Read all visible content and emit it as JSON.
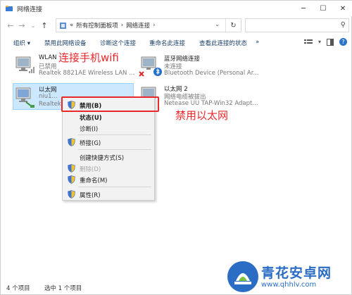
{
  "window": {
    "title": "网络连接"
  },
  "address": {
    "prefix": "«",
    "crumbs": [
      "所有控制面板项",
      "网络连接"
    ],
    "search_placeholder": ""
  },
  "commands": {
    "organize": "组织 ▾",
    "disable_device": "禁用此网络设备",
    "diagnose": "诊断这个连接",
    "rename": "重命名此连接",
    "view_settings": "查看此连接的状态",
    "more": "»"
  },
  "connections": [
    {
      "name": "WLAN",
      "status": "已禁用",
      "device": "Realtek 8821AE Wireless LAN ..."
    },
    {
      "name": "蓝牙网络连接",
      "status": "未连接",
      "device": "Bluetooth Device (Personal Ar..."
    },
    {
      "name": "以太网",
      "status": "niu1...",
      "device": "Realtek..."
    },
    {
      "name": "以太网 2",
      "status": "网络电缆被拔出",
      "device": "Netease UU TAP-Win32 Adapt..."
    }
  ],
  "annotations": {
    "wifi": "连接手机wifi",
    "ethernet": "禁用以太网"
  },
  "context_menu": {
    "disable": "禁用(B)",
    "status": "状态(U)",
    "diagnose": "诊断(I)",
    "bridge": "桥接(G)",
    "shortcut": "创建快捷方式(S)",
    "delete": "删除(D)",
    "rename": "重命名(M)",
    "properties": "属性(R)"
  },
  "statusbar": {
    "count": "4 个项目",
    "selected": "选中 1 个项目"
  },
  "watermark": {
    "name": "青花安卓网",
    "url": "www.qhhlv.com"
  },
  "colors": {
    "accent": "#e8282b",
    "selection": "#cce8ff",
    "link": "#1a3e66",
    "watermark": "#2b6cc4"
  }
}
